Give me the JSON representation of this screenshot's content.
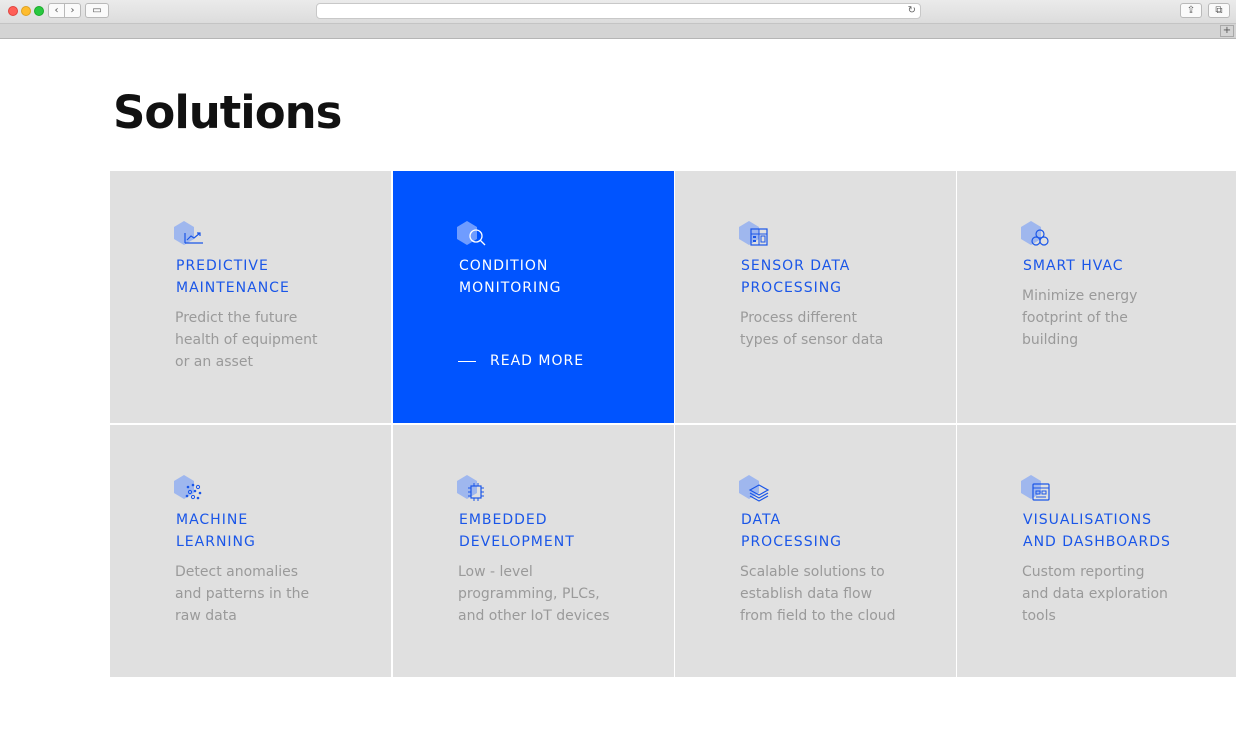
{
  "browser": {
    "back_glyph": "‹",
    "forward_glyph": "›",
    "sidebar_glyph": "▭",
    "reload_glyph": "↻",
    "share_glyph": "⇪",
    "tabs_glyph": "⧉",
    "new_tab_glyph": "+"
  },
  "page": {
    "title": "Solutions"
  },
  "colors": {
    "accent": "#0054ff",
    "title_blue": "#1a56e8",
    "card_bg": "#e0e0e0",
    "desc_gray": "#9a9a9a",
    "icon_hex": "#9fb7ee"
  },
  "solutions": [
    {
      "icon": "trend-chart-icon",
      "title_lines": [
        "PREDICTIVE",
        "MAINTENANCE"
      ],
      "desc_lines": [
        "Predict the future",
        "health of equipment",
        "or an asset"
      ],
      "active": false
    },
    {
      "icon": "magnifier-icon",
      "title_lines": [
        "CONDITION",
        "MONITORING"
      ],
      "desc_lines": [],
      "active": true,
      "read_more": "READ MORE"
    },
    {
      "icon": "sensor-panel-icon",
      "title_lines": [
        "SENSOR DATA",
        "PROCESSING"
      ],
      "desc_lines": [
        "Process different",
        "types of sensor data"
      ],
      "active": false
    },
    {
      "icon": "fan-icon",
      "title_lines": [
        "SMART HVAC"
      ],
      "desc_lines": [
        "Minimize energy",
        "footprint of the",
        "building"
      ],
      "active": false
    },
    {
      "icon": "dots-cluster-icon",
      "title_lines": [
        "MACHINE",
        "LEARNING"
      ],
      "desc_lines": [
        "Detect anomalies",
        "and patterns in the",
        "raw data"
      ],
      "active": false
    },
    {
      "icon": "chip-icon",
      "title_lines": [
        "EMBEDDED",
        "DEVELOPMENT"
      ],
      "desc_lines": [
        "Low - level",
        "programming, PLCs,",
        "and other IoT devices"
      ],
      "active": false
    },
    {
      "icon": "layers-icon",
      "title_lines": [
        "DATA",
        "PROCESSING"
      ],
      "desc_lines": [
        "Scalable solutions to",
        "establish data flow",
        "from field to the cloud"
      ],
      "active": false
    },
    {
      "icon": "dashboard-icon",
      "title_lines": [
        "VISUALISATIONS",
        "AND DASHBOARDS"
      ],
      "desc_lines": [
        "Custom reporting",
        "and data exploration",
        "tools"
      ],
      "active": false
    }
  ]
}
